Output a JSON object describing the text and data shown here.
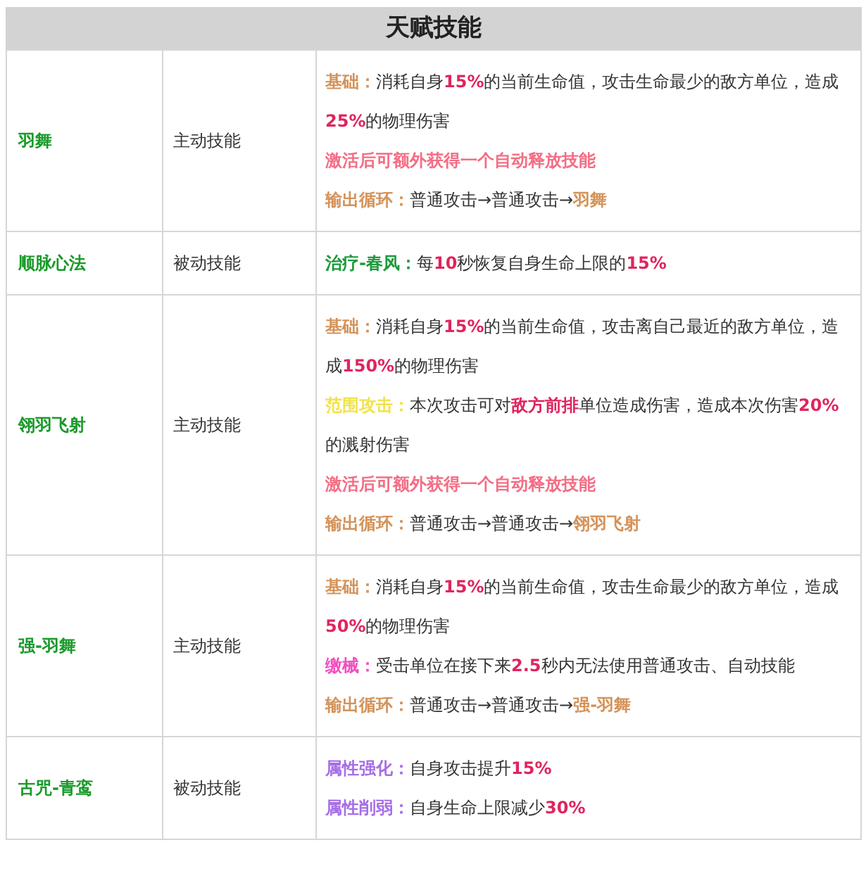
{
  "table": {
    "title": "天赋技能",
    "rows": [
      {
        "name": "羽舞",
        "type": "主动技能",
        "lines": [
          [
            {
              "text": "基础：",
              "color": "#d4935a"
            },
            {
              "text": "消耗自身"
            },
            {
              "text": "15%",
              "color": "#e0245e"
            },
            {
              "text": "的当前生命值，攻击生命最少的敌方单位，造成"
            },
            {
              "text": "25%",
              "color": "#e0245e"
            },
            {
              "text": "的物理伤害"
            }
          ],
          [
            {
              "text": "激活后可额外获得一个自动释放技能",
              "color": "#f36f86"
            }
          ],
          [
            {
              "text": "输出循环：",
              "color": "#d4935a"
            },
            {
              "text": "普通攻击→普通攻击→"
            },
            {
              "text": "羽舞",
              "color": "#d4935a"
            }
          ]
        ]
      },
      {
        "name": "顺脉心法",
        "type": "被动技能",
        "lines": [
          [
            {
              "text": "治疗-春风：",
              "color": "#1e9a3c"
            },
            {
              "text": "每"
            },
            {
              "text": "10",
              "color": "#e0245e"
            },
            {
              "text": "秒恢复自身生命上限的"
            },
            {
              "text": "15%",
              "color": "#e0245e"
            }
          ]
        ]
      },
      {
        "name": "翎羽飞射",
        "type": "主动技能",
        "lines": [
          [
            {
              "text": "基础：",
              "color": "#d4935a"
            },
            {
              "text": "消耗自身"
            },
            {
              "text": "15%",
              "color": "#e0245e"
            },
            {
              "text": "的当前生命值，攻击离自己最近的敌方单位，造成"
            },
            {
              "text": "150%",
              "color": "#e0245e"
            },
            {
              "text": "的物理伤害"
            }
          ],
          [
            {
              "text": "范围攻击：",
              "color": "#f2e34c"
            },
            {
              "text": "本次攻击可对"
            },
            {
              "text": "敌方前排",
              "color": "#e0245e"
            },
            {
              "text": "单位造成伤害，造成本次伤害"
            },
            {
              "text": "20%",
              "color": "#e0245e"
            },
            {
              "text": "的溅射伤害"
            }
          ],
          [
            {
              "text": "激活后可额外获得一个自动释放技能",
              "color": "#f36f86"
            }
          ],
          [
            {
              "text": "输出循环：",
              "color": "#d4935a"
            },
            {
              "text": "普通攻击→普通攻击→"
            },
            {
              "text": "翎羽飞射",
              "color": "#d4935a"
            }
          ]
        ]
      },
      {
        "name": "强-羽舞",
        "type": "主动技能",
        "lines": [
          [
            {
              "text": "基础：",
              "color": "#d4935a"
            },
            {
              "text": "消耗自身"
            },
            {
              "text": "15%",
              "color": "#e0245e"
            },
            {
              "text": "的当前生命值，攻击生命最少的敌方单位，造成"
            },
            {
              "text": "50%",
              "color": "#e0245e"
            },
            {
              "text": "的物理伤害"
            }
          ],
          [
            {
              "text": "缴械：",
              "color": "#f050c0"
            },
            {
              "text": "受击单位在接下来"
            },
            {
              "text": "2.5",
              "color": "#e0245e"
            },
            {
              "text": "秒内无法使用普通攻击、自动技能"
            }
          ],
          [
            {
              "text": "输出循环：",
              "color": "#d4935a"
            },
            {
              "text": "普通攻击→普通攻击→"
            },
            {
              "text": "强-羽舞",
              "color": "#d4935a"
            }
          ]
        ]
      },
      {
        "name": "古咒-青鸾",
        "type": "被动技能",
        "lines": [
          [
            {
              "text": "属性强化：",
              "color": "#a66ee6"
            },
            {
              "text": "自身攻击提升"
            },
            {
              "text": "15%",
              "color": "#e0245e"
            }
          ],
          [
            {
              "text": "属性削弱：",
              "color": "#a66ee6"
            },
            {
              "text": "自身生命上限减少"
            },
            {
              "text": "30%",
              "color": "#e0245e"
            }
          ]
        ]
      }
    ]
  }
}
